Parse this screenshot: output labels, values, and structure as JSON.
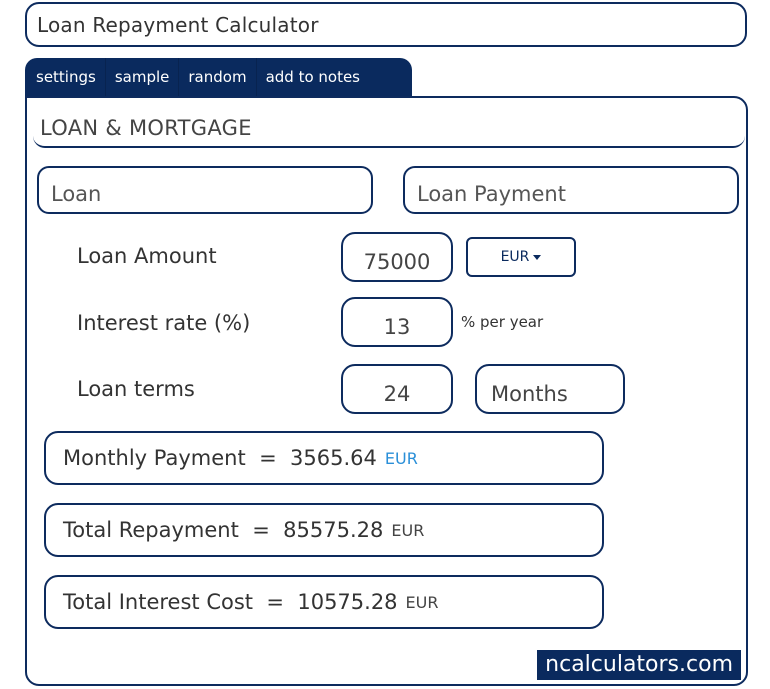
{
  "title": "Loan Repayment Calculator",
  "tabs": [
    {
      "label": "settings"
    },
    {
      "label": "sample"
    },
    {
      "label": "random"
    },
    {
      "label": "add to notes"
    }
  ],
  "section": {
    "heading": "LOAN & MORTGAGE"
  },
  "subtabs": [
    {
      "label": "Loan"
    },
    {
      "label": "Loan Payment"
    }
  ],
  "inputs": {
    "loan_amount": {
      "label": "Loan Amount",
      "value": "75000",
      "currency": "EUR"
    },
    "interest_rate": {
      "label": "Interest rate (%)",
      "value": "13",
      "unit": "% per year"
    },
    "loan_terms": {
      "label": "Loan terms",
      "value": "24",
      "unit": "Months"
    }
  },
  "results": {
    "monthly_payment": {
      "label": "Monthly Payment",
      "eq": "=",
      "value": "3565.64",
      "currency": "EUR"
    },
    "total_repayment": {
      "label": "Total Repayment",
      "eq": "=",
      "value": "85575.28",
      "currency": "EUR"
    },
    "total_interest": {
      "label": "Total Interest Cost",
      "eq": "=",
      "value": "10575.28",
      "currency": "EUR"
    }
  },
  "brand": "ncalculators.com",
  "colors": {
    "navy": "#0a2a5e",
    "accent_blue": "#2a8fd8"
  }
}
